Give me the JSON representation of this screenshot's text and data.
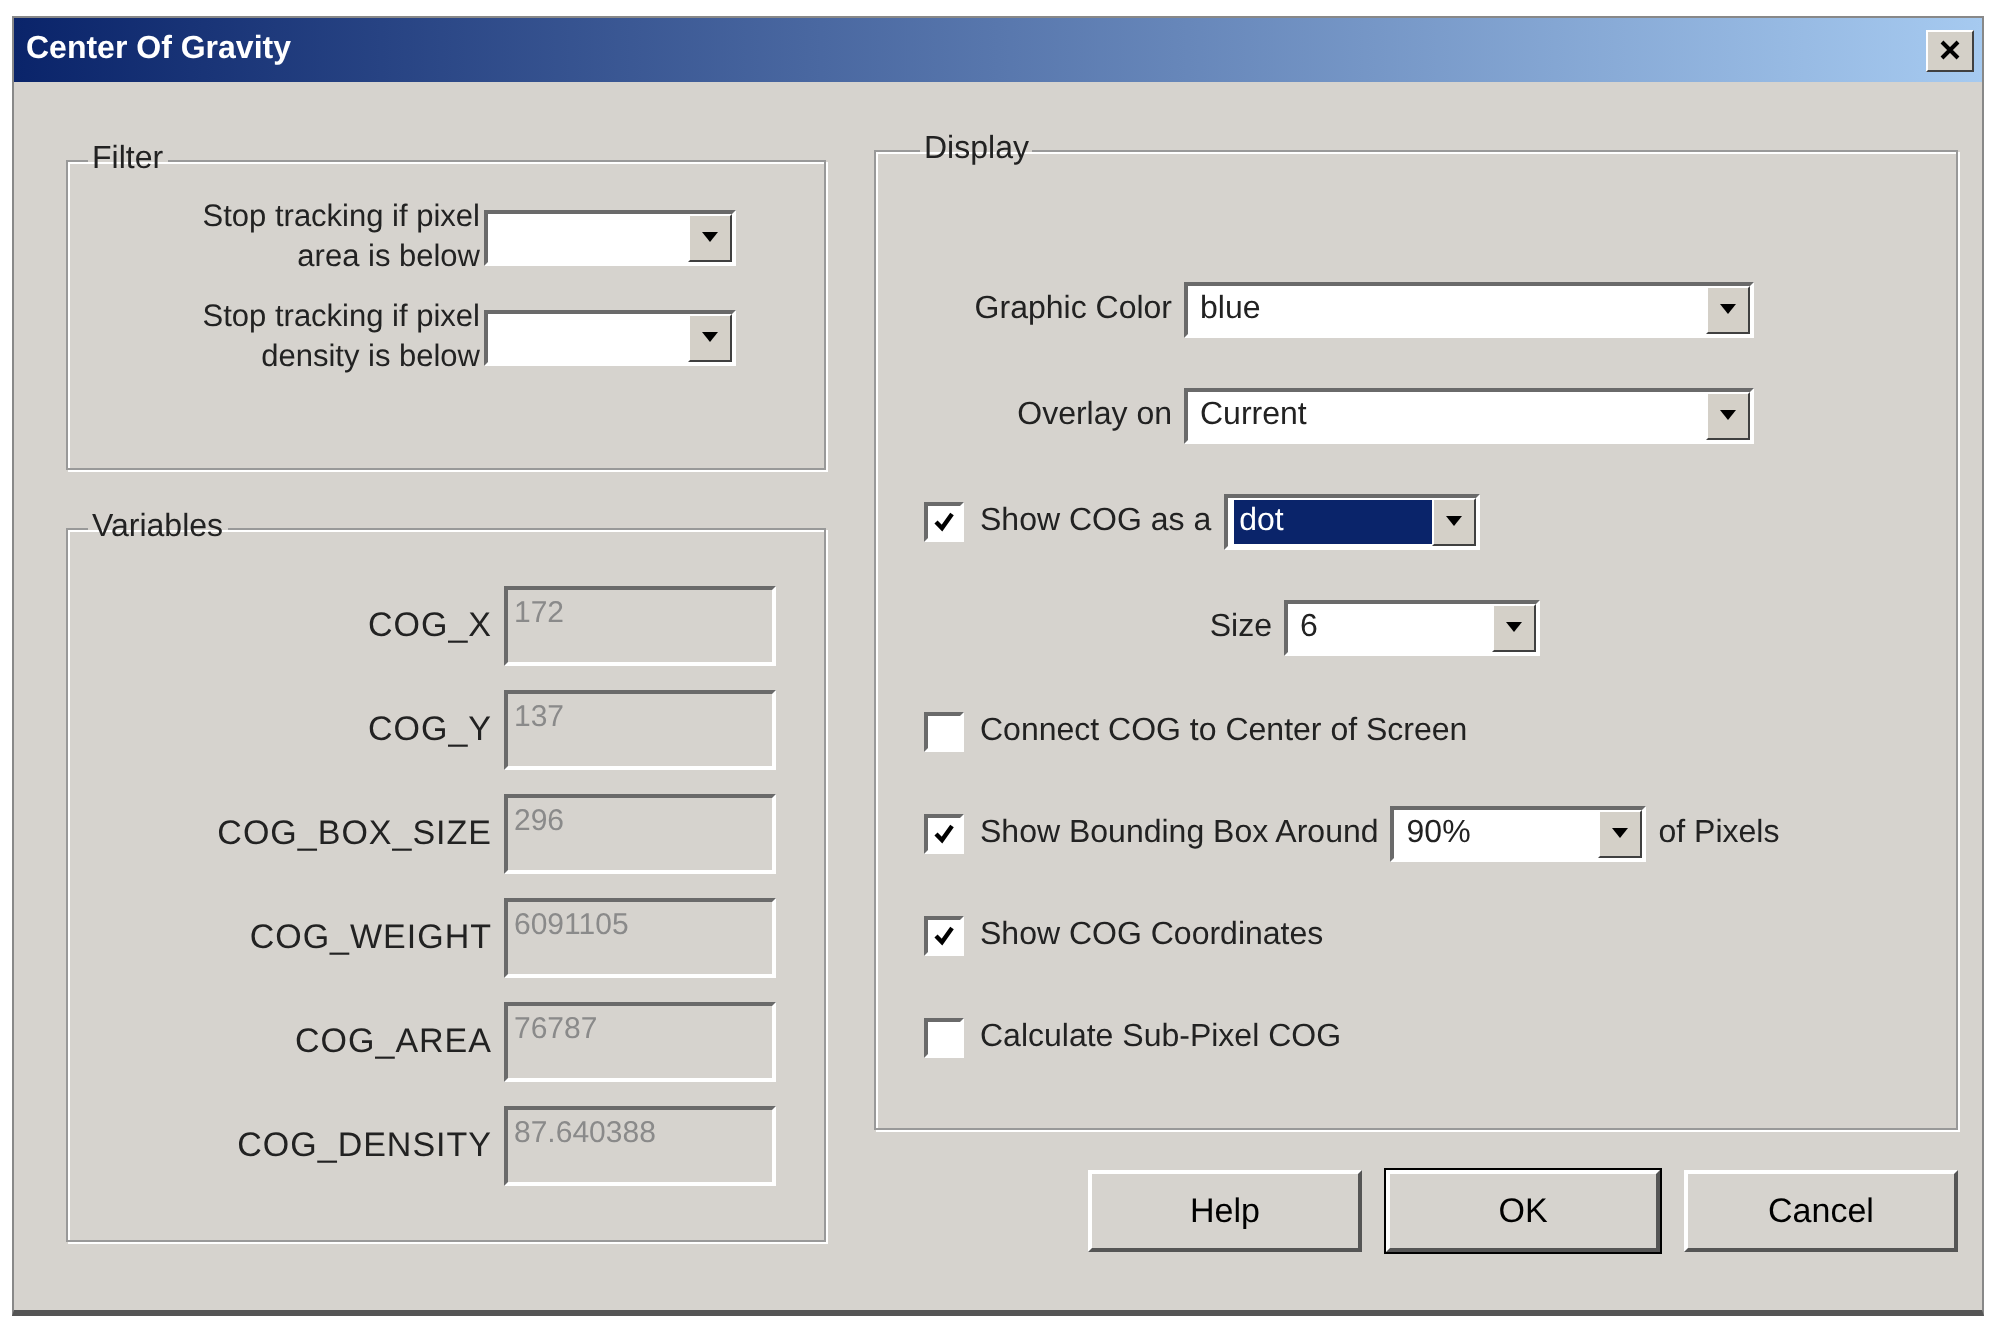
{
  "window": {
    "title": "Center Of Gravity"
  },
  "filter": {
    "title": "Filter",
    "fields": [
      {
        "label": "Stop tracking if pixel area is below"
      },
      {
        "label": "Stop tracking if pixel density is below"
      }
    ]
  },
  "variables": {
    "title": "Variables",
    "fields": [
      {
        "label": "COG_X",
        "value": "172",
        "disabled": true
      },
      {
        "label": "COG_Y",
        "value": "137",
        "disabled": true
      },
      {
        "label": "COG_BOX_SIZE",
        "value": "296",
        "disabled": true
      },
      {
        "label": "COG_WEIGHT",
        "value": "6091105",
        "disabled": true
      },
      {
        "label": "COG_AREA",
        "value": "76787",
        "disabled": true
      },
      {
        "label": "COG_DENSITY",
        "value": "87.640388",
        "disabled": true
      }
    ]
  },
  "display": {
    "title": "Display",
    "graphic_color": {
      "label": "Graphic Color",
      "value": "blue"
    },
    "overlay_on": {
      "label": "Overlay on",
      "value": "Current"
    },
    "show_cog": {
      "label": "Show COG as a",
      "checked": true,
      "value": "dot",
      "highlighted": true
    },
    "size": {
      "label": "Size",
      "value": "6"
    },
    "options": [
      {
        "kind": "checkbox",
        "label": "Connect COG to Center of Screen",
        "checked": false
      },
      {
        "kind": "checkbox_dropdown",
        "label": "Show Bounding Box Around",
        "checked": true,
        "value": "90%",
        "suffix": "of Pixels"
      },
      {
        "kind": "checkbox",
        "label": "Show COG Coordinates",
        "checked": true
      },
      {
        "kind": "checkbox",
        "label": "Calculate Sub-Pixel COG",
        "checked": false
      }
    ]
  },
  "buttons": [
    {
      "label": "Help",
      "default": false
    },
    {
      "label": "OK",
      "default": true
    },
    {
      "label": "Cancel",
      "default": false
    }
  ]
}
